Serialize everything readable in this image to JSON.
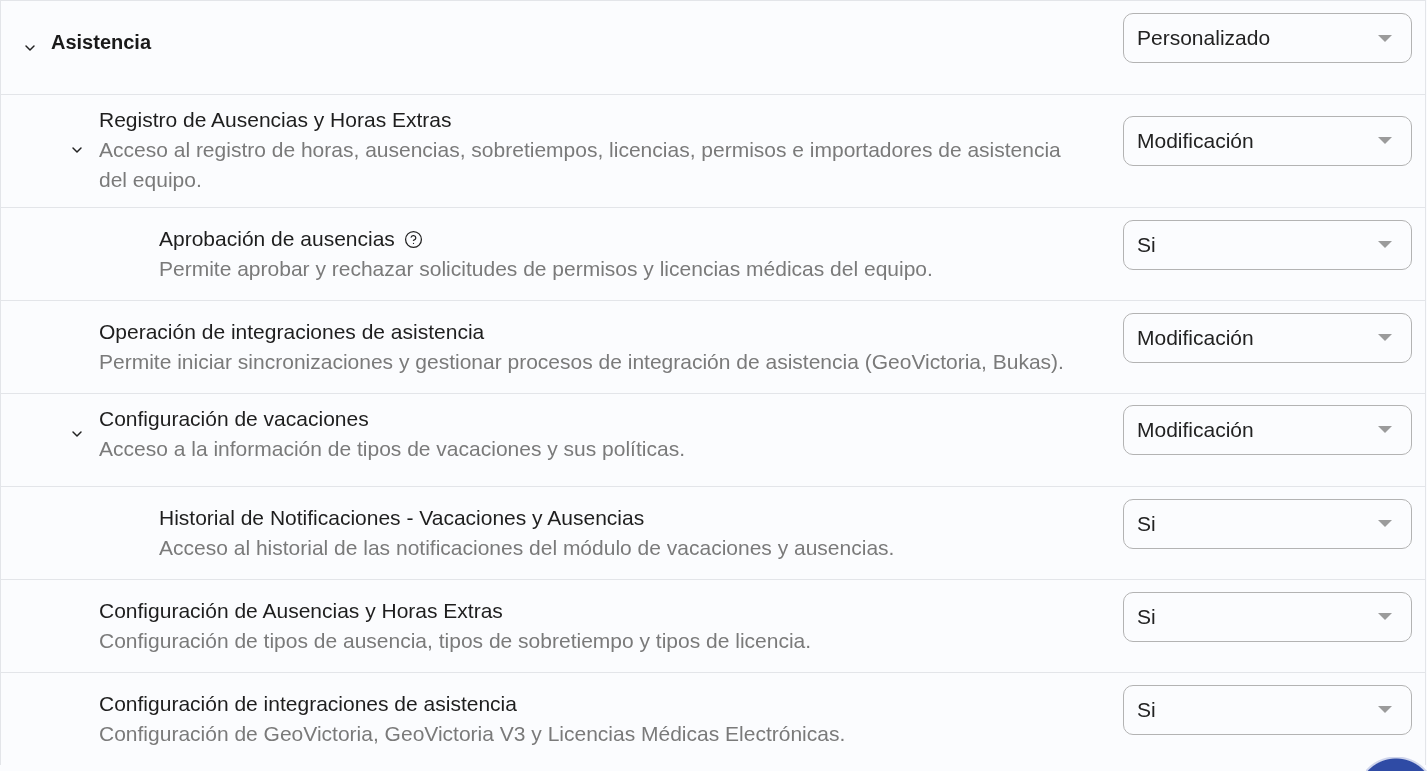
{
  "section": {
    "title": "Asistencia",
    "expanded": true,
    "value": "Personalizado",
    "items": [
      {
        "title": "Registro de Ausencias y Horas Extras",
        "description": "Acceso al registro de horas, ausencias, sobretiempos, licencias, permisos e importadores de asistencia del equipo.",
        "value": "Modificación",
        "help": false,
        "expanded": true,
        "children": [
          {
            "title": "Aprobación de ausencias",
            "description": "Permite aprobar y rechazar solicitudes de permisos y licencias médicas del equipo.",
            "value": "Si",
            "help": true
          }
        ]
      },
      {
        "title": "Operación de integraciones de asistencia",
        "description": "Permite iniciar sincronizaciones y gestionar procesos de integración de asistencia (GeoVictoria, Bukas).",
        "value": "Modificación",
        "help": false
      },
      {
        "title": "Configuración de vacaciones",
        "description": "Acceso a la información de tipos de vacaciones y sus políticas.",
        "value": "Modificación",
        "help": false,
        "expanded": true,
        "children": [
          {
            "title": "Historial de Notificaciones - Vacaciones y Ausencias",
            "description": "Acceso al historial de las notificaciones del módulo de vacaciones y ausencias.",
            "value": "Si",
            "help": false
          }
        ]
      },
      {
        "title": "Configuración de Ausencias y Horas Extras",
        "description": "Configuración de tipos de ausencia, tipos de sobretiempo y tipos de licencia.",
        "value": "Si",
        "help": false
      },
      {
        "title": "Configuración de integraciones de asistencia",
        "description": "Configuración de GeoVictoria, GeoVictoria V3 y Licencias Médicas Electrónicas.",
        "value": "Si",
        "help": false
      }
    ]
  }
}
